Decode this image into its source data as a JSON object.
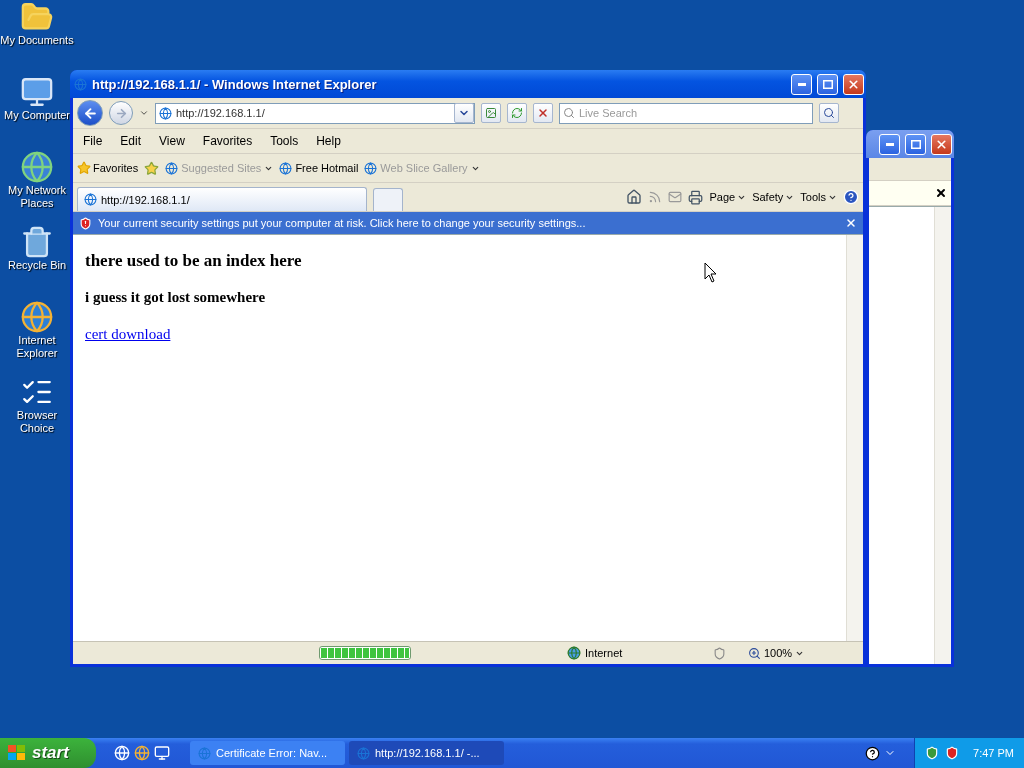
{
  "desktop_icons": [
    {
      "label": "My Documents",
      "kind": "documents"
    },
    {
      "label": "My Computer",
      "kind": "computer"
    },
    {
      "label": "My Network Places",
      "kind": "network"
    },
    {
      "label": "Recycle Bin",
      "kind": "recycle"
    },
    {
      "label": "Internet Explorer",
      "kind": "browser"
    },
    {
      "label": "Browser Choice",
      "kind": "shortcut"
    }
  ],
  "window": {
    "title": "http://192.168.1.1/ - Windows Internet Explorer"
  },
  "address": {
    "value": "http://192.168.1.1/"
  },
  "search": {
    "placeholder": "Live Search"
  },
  "menu": [
    "File",
    "Edit",
    "View",
    "Favorites",
    "Tools",
    "Help"
  ],
  "favorites_bar": {
    "favorites": "Favorites",
    "links": [
      {
        "label": "Suggested Sites",
        "disabled": true,
        "dropdown": true
      },
      {
        "label": "Free Hotmail",
        "disabled": false,
        "dropdown": false
      },
      {
        "label": "Web Slice Gallery",
        "disabled": true,
        "dropdown": true
      }
    ]
  },
  "tabs": [
    {
      "label": "http://192.168.1.1/",
      "selected": true
    }
  ],
  "command_bar": [
    "Page",
    "Safety",
    "Tools"
  ],
  "info_bar": "Your current security settings put your computer at risk. Click here to change your security settings...",
  "page": {
    "heading": "there used to be an index here",
    "subheading": "i guess it got lost somewhere",
    "link": "cert download"
  },
  "status_bar": {
    "progress": {
      "level": 1
    },
    "zone": "Internet",
    "zoom": "100%"
  },
  "taskbar": {
    "start": "start",
    "tasks": [
      {
        "label": "Certificate Error: Nav...",
        "selected": false
      },
      {
        "label": "http://192.168.1.1/ -...",
        "selected": true
      }
    ],
    "clock": "7:47 PM"
  }
}
